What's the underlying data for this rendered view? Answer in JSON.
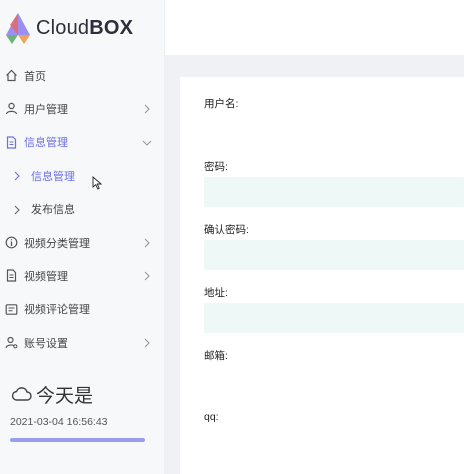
{
  "brand": {
    "name_light": "Cloud",
    "name_bold": "BOX"
  },
  "sidebar": {
    "items": [
      {
        "label": "首页",
        "icon": "home-icon"
      },
      {
        "label": "用户管理",
        "icon": "user-icon"
      },
      {
        "label": "信息管理",
        "icon": "document-icon",
        "expanded": true
      },
      {
        "label": "信息管理",
        "icon": "chevron-right-icon",
        "sub": true,
        "active": true
      },
      {
        "label": "发布信息",
        "icon": "chevron-right-icon",
        "sub": true
      },
      {
        "label": "视频分类管理",
        "icon": "info-icon"
      },
      {
        "label": "视频管理",
        "icon": "file-icon"
      },
      {
        "label": "视频评论管理",
        "icon": "comment-icon"
      },
      {
        "label": "账号设置",
        "icon": "user-settings-icon"
      }
    ]
  },
  "weather": {
    "title": "今天是",
    "datetime": "2021-03-04 16:56:43"
  },
  "form": {
    "fields": [
      {
        "label": "用户名:"
      },
      {
        "label": "密码:"
      },
      {
        "label": "确认密码:"
      },
      {
        "label": "地址:"
      },
      {
        "label": "邮箱:"
      },
      {
        "label": "qq:"
      }
    ]
  },
  "colors": {
    "accent": "#6c6fe0",
    "input_bg": "#eef8f7",
    "sidebar_bg": "#f7f8fa"
  }
}
